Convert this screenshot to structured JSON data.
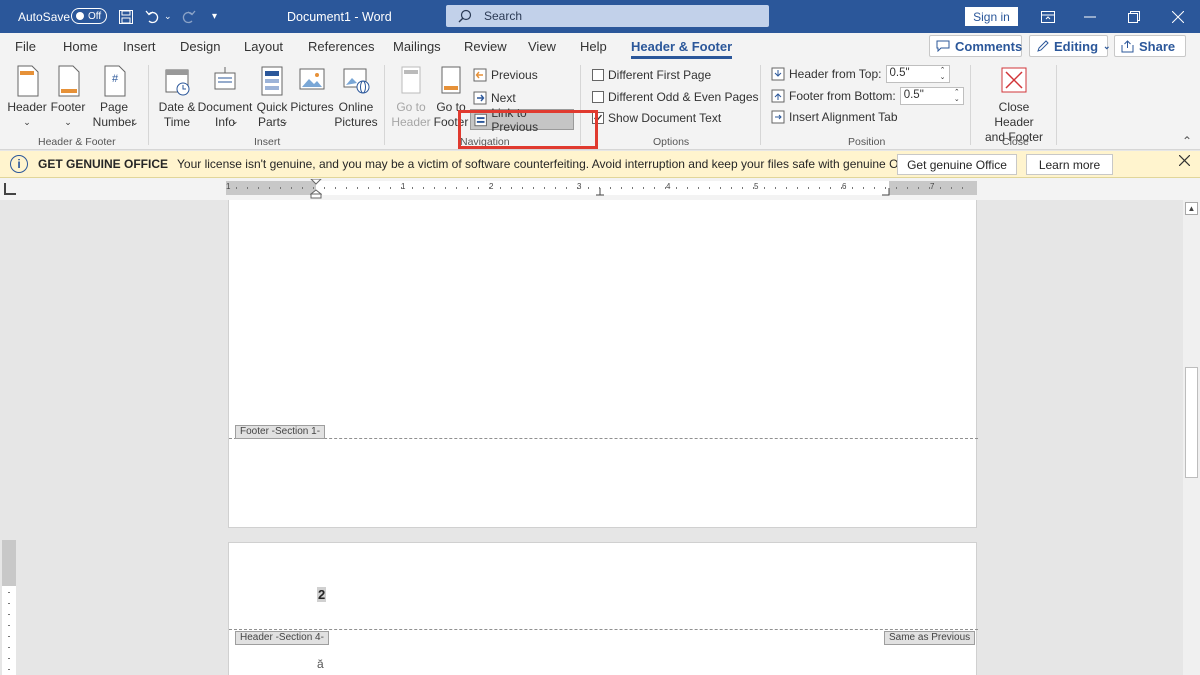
{
  "titlebar": {
    "autosave_label": "AutoSave",
    "autosave_state": "Off",
    "doc_title": "Document1  -  Word",
    "search_placeholder": "Search",
    "sign_in": "Sign in"
  },
  "menu": {
    "tabs": [
      "File",
      "Home",
      "Insert",
      "Design",
      "Layout",
      "References",
      "Mailings",
      "Review",
      "View",
      "Help",
      "Header & Footer"
    ],
    "active_tab": "Header & Footer",
    "comments": "Comments",
    "editing": "Editing",
    "share": "Share"
  },
  "ribbon": {
    "hf_group": {
      "header": "Header",
      "footer": "Footer",
      "page_number_1": "Page",
      "page_number_2": "Number",
      "label": "Header & Footer"
    },
    "insert_group": {
      "date_1": "Date &",
      "date_2": "Time",
      "docinfo_1": "Document",
      "docinfo_2": "Info",
      "quickparts_1": "Quick",
      "quickparts_2": "Parts",
      "pictures": "Pictures",
      "online_1": "Online",
      "online_2": "Pictures",
      "label": "Insert"
    },
    "nav_group": {
      "goto_header_1": "Go to",
      "goto_header_2": "Header",
      "goto_footer_1": "Go to",
      "goto_footer_2": "Footer",
      "previous": "Previous",
      "next": "Next",
      "link_to_previous": "Link to Previous",
      "label": "Navigation"
    },
    "options_group": {
      "different_first_page": "Different First Page",
      "different_odd_even": "Different Odd & Even Pages",
      "show_document_text": "Show Document Text",
      "show_document_text_checked": true,
      "label": "Options"
    },
    "position_group": {
      "header_from_top": "Header from Top:",
      "header_value": "0.5\"",
      "footer_from_bottom": "Footer from Bottom:",
      "footer_value": "0.5\"",
      "insert_alignment_tab": "Insert Alignment Tab",
      "label": "Position"
    },
    "close_group": {
      "close_1": "Close Header",
      "close_2": "and Footer",
      "label": "Close"
    }
  },
  "notice": {
    "heading": "GET GENUINE OFFICE",
    "message": "Your license isn't genuine, and you may be a victim of software counterfeiting. Avoid interruption and keep your files safe with genuine Office today.",
    "get_genuine": "Get genuine Office",
    "learn_more": "Learn more"
  },
  "ruler": {
    "numbers": [
      "1",
      "1",
      "2",
      "3",
      "4",
      "5",
      "6",
      "7"
    ]
  },
  "document": {
    "footer_tag": "Footer -Section 1-",
    "header_tag": "Header -Section 4-",
    "same_as_previous": "Same as Previous",
    "page_number": "2",
    "body_char": "ă"
  },
  "colors": {
    "accent": "#2b579a",
    "highlight": "#e03a2f",
    "notice_bg": "#fff4ce"
  }
}
